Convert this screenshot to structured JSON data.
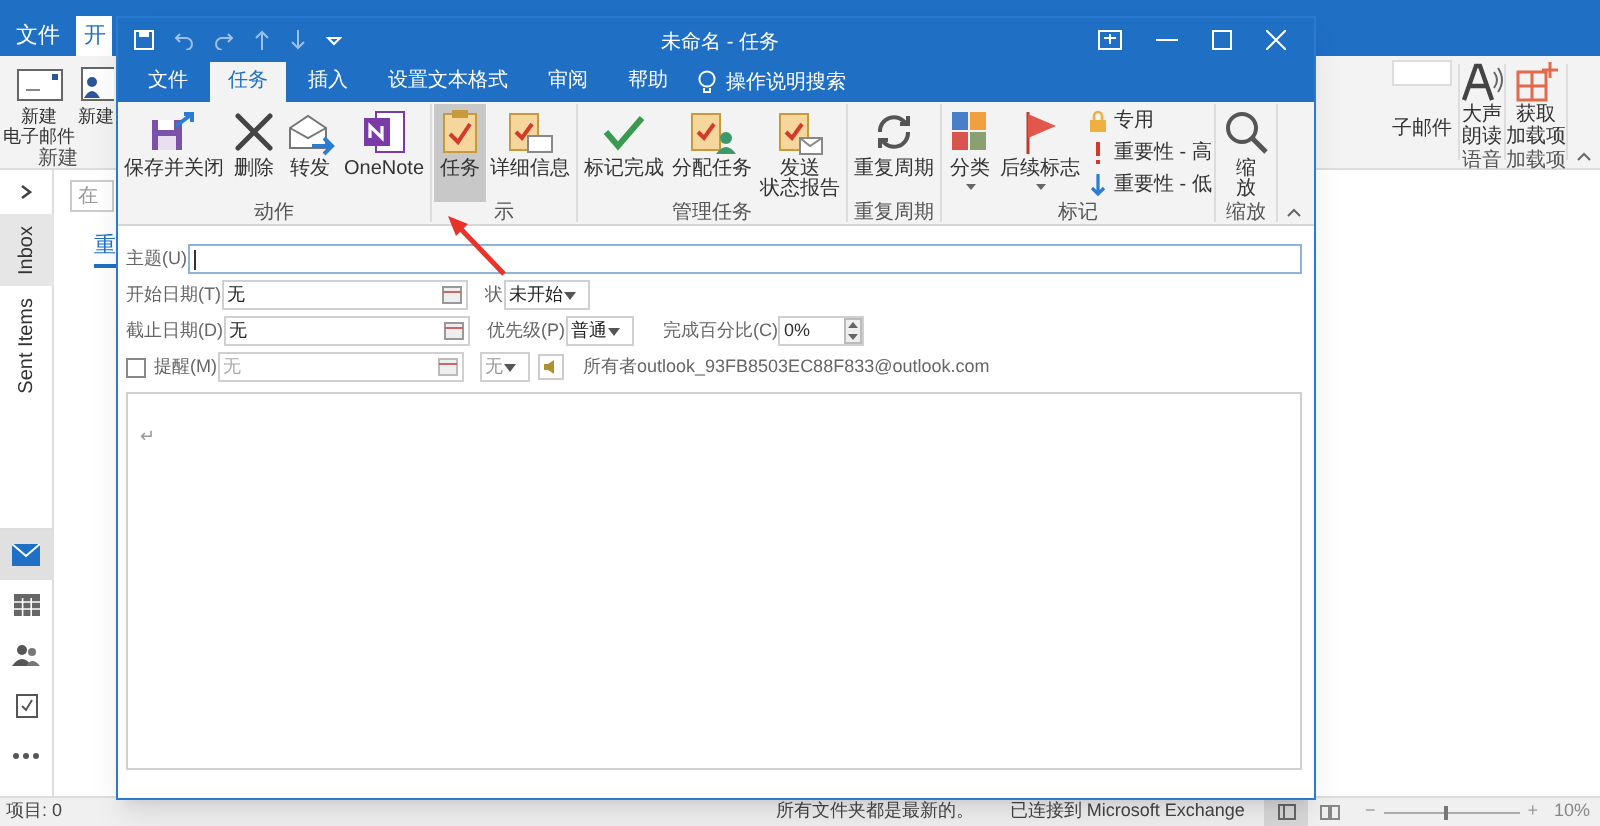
{
  "main_window": {
    "tabs": [
      {
        "label": "文件",
        "selected": false
      },
      {
        "label": "开",
        "selected": true
      }
    ],
    "ribbon_left": [
      {
        "kind": "new_mail",
        "lines": [
          "新建",
          "电子邮件"
        ]
      },
      {
        "kind": "new_item",
        "lines": [
          "新建"
        ]
      }
    ],
    "new_group": "新建",
    "ribbon_cut_text": "子邮件",
    "read_aloud": {
      "lines": [
        "大声",
        "朗读"
      ],
      "group": "语音"
    },
    "get_addins": {
      "lines": [
        "获取",
        "加载项"
      ],
      "group": "加载项"
    },
    "search_placeholder": "在",
    "side_tabs": [
      {
        "label": "Inbox",
        "selected": true
      },
      {
        "label": "Sent Items",
        "selected": false
      }
    ],
    "list_link": "重",
    "nav": [
      {
        "kind": "mail",
        "selected": true
      },
      {
        "kind": "calendar",
        "selected": false
      },
      {
        "kind": "people",
        "selected": false
      },
      {
        "kind": "tasks",
        "selected": false
      },
      {
        "kind": "more",
        "selected": false
      }
    ],
    "status_bar": {
      "items": "项目: 0",
      "sync": "所有文件夹都是最新的。",
      "connection": "已连接到 Microsoft Exchange",
      "zoom_out": "−",
      "zoom_slider": {
        "level": 0.45
      },
      "zoom_in": "+",
      "zoom": "10%"
    }
  },
  "task_window": {
    "title": "未命名 - 任务",
    "tabs": [
      {
        "label": "文件",
        "selected": false
      },
      {
        "label": "任务",
        "selected": true
      },
      {
        "label": "插入",
        "selected": false
      },
      {
        "label": "设置文本格式",
        "selected": false
      },
      {
        "label": "审阅",
        "selected": false
      },
      {
        "label": "帮助",
        "selected": false
      }
    ],
    "tell_me": "操作说明搜索",
    "ribbon_groups": [
      {
        "label": "动作",
        "buttons": [
          {
            "kind": "save_close",
            "lines": [
              "保存并关闭"
            ],
            "selected": false
          },
          {
            "kind": "delete",
            "lines": [
              "删除"
            ],
            "selected": false
          },
          {
            "kind": "forward",
            "lines": [
              "转发"
            ],
            "selected": false
          },
          {
            "kind": "onenote",
            "lines": [
              "OneNote"
            ],
            "selected": false
          }
        ]
      },
      {
        "label": "示",
        "buttons": [
          {
            "kind": "task",
            "lines": [
              "任务"
            ],
            "selected": true
          },
          {
            "kind": "details",
            "lines": [
              "详细信息"
            ],
            "selected": false
          }
        ]
      },
      {
        "label": "管理任务",
        "buttons": [
          {
            "kind": "complete",
            "lines": [
              "标记完成"
            ],
            "selected": false
          },
          {
            "kind": "assign",
            "lines": [
              "分配任务"
            ],
            "selected": false
          },
          {
            "kind": "status_report",
            "lines": [
              "发送",
              "状态报告"
            ],
            "selected": false
          }
        ]
      },
      {
        "label": "重复周期",
        "buttons": [
          {
            "kind": "recurrence",
            "lines": [
              "重复周期"
            ],
            "selected": false
          }
        ]
      },
      {
        "label": "标记",
        "buttons": [
          {
            "kind": "categorize",
            "lines": [
              "分类"
            ],
            "dropdown": true,
            "selected": false
          },
          {
            "kind": "follow_up",
            "lines": [
              "后续标志"
            ],
            "dropdown": true,
            "selected": false
          }
        ],
        "small_buttons": [
          {
            "kind": "private",
            "label": "专用"
          },
          {
            "kind": "high",
            "label": "重要性 - 高"
          },
          {
            "kind": "low",
            "label": "重要性 - 低"
          }
        ]
      },
      {
        "label": "缩放",
        "buttons": [
          {
            "kind": "zoom",
            "lines": [
              "缩",
              "放"
            ],
            "selected": false
          }
        ]
      }
    ],
    "form": {
      "subject": {
        "label": "主题(U)"
      },
      "start_date": {
        "label": "开始日期(T)",
        "value": "无"
      },
      "status": {
        "label": "状",
        "value": "未开始"
      },
      "due_date": {
        "label": "截止日期(D)",
        "value": "无"
      },
      "priority": {
        "label": "优先级(P)",
        "value": "普通"
      },
      "percent": {
        "label": "完成百分比(C)",
        "value": "0%"
      },
      "reminder": {
        "label": "提醒(M)",
        "checked": false,
        "date": "无",
        "time": "无",
        "disabled": true
      },
      "owner": {
        "label": "所有者",
        "value": "outlook_93FB8503EC88F833@outlook.com"
      },
      "body_mark": "↵"
    }
  }
}
